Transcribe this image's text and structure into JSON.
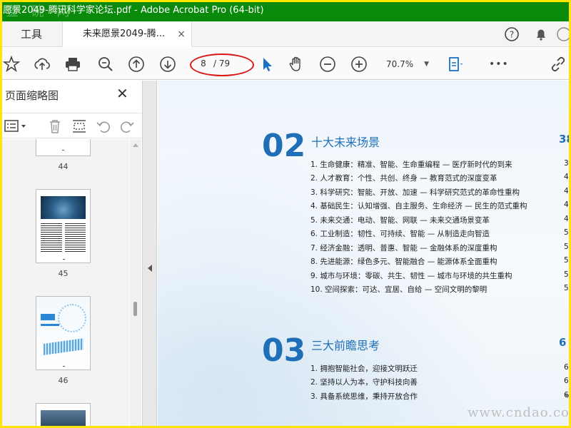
{
  "window": {
    "title": "愿景2049-腾讯科学家论坛.pdf - Adobe Acrobat Pro (64-bit)",
    "watermark": "查 碗 网"
  },
  "tabs": {
    "tools_label": "工具",
    "doc_label": "未来愿景2049-腾...",
    "close": "×"
  },
  "toolbar": {
    "current_page": "8",
    "total_pages": "/ 79",
    "zoom": "70.7%",
    "zoom_caret": "▼",
    "more": "•••"
  },
  "thumbnails_pane": {
    "title": "页面缩略图",
    "close": "✕",
    "pages": [
      "44",
      "45",
      "46"
    ]
  },
  "document": {
    "sections": [
      {
        "number": "02",
        "title": "十大未来场景",
        "page": "38",
        "items": [
          {
            "text": "1. 生命健康：精准、智能、生命重编程 — 医疗新时代的到来",
            "page": "3"
          },
          {
            "text": "2. 人才教育：个性、共创、终身 — 教育范式的深度变革",
            "page": "4"
          },
          {
            "text": "3. 科学研究：智能、开放、加速 — 科学研究范式的革命性重构",
            "page": "4"
          },
          {
            "text": "4. 基础民生：认知增强、自主服务、生命经济 — 民生的范式重构",
            "page": "4"
          },
          {
            "text": "5. 未来交通：电动、智能、网联 — 未来交通场景变革",
            "page": "4"
          },
          {
            "text": "6. 工业制造：韧性、可持续、智能 — 从制造走向智造",
            "page": "5"
          },
          {
            "text": "7. 经济金融：透明、普惠、智能 — 金融体系的深度重构",
            "page": "5"
          },
          {
            "text": "8. 先进能源：绿色多元、智能融合 — 能源体系全面重构",
            "page": "5"
          },
          {
            "text": "9. 城市与环境：零碳、共生、韧性 — 城市与环境的共生重构",
            "page": "5"
          },
          {
            "text": "10. 空间探索：可达、宜居、自给 — 空间文明的黎明",
            "page": "5"
          }
        ]
      },
      {
        "number": "03",
        "title": "三大前瞻思考",
        "page": "6",
        "items": [
          {
            "text": "1. 拥抱智能社会，迎接文明跃迁",
            "page": "6"
          },
          {
            "text": "2. 坚持以人为本，守护科技向善",
            "page": "6"
          },
          {
            "text": "3. 具备系统思维，秉持开放合作",
            "page": "6"
          }
        ]
      }
    ]
  },
  "footer_watermark": "www.cndao.com",
  "colors": {
    "accent": "#1f6fb8",
    "titlebar": "#0a8a0a",
    "frame": "#ffe400",
    "annotation": "#d71919"
  }
}
